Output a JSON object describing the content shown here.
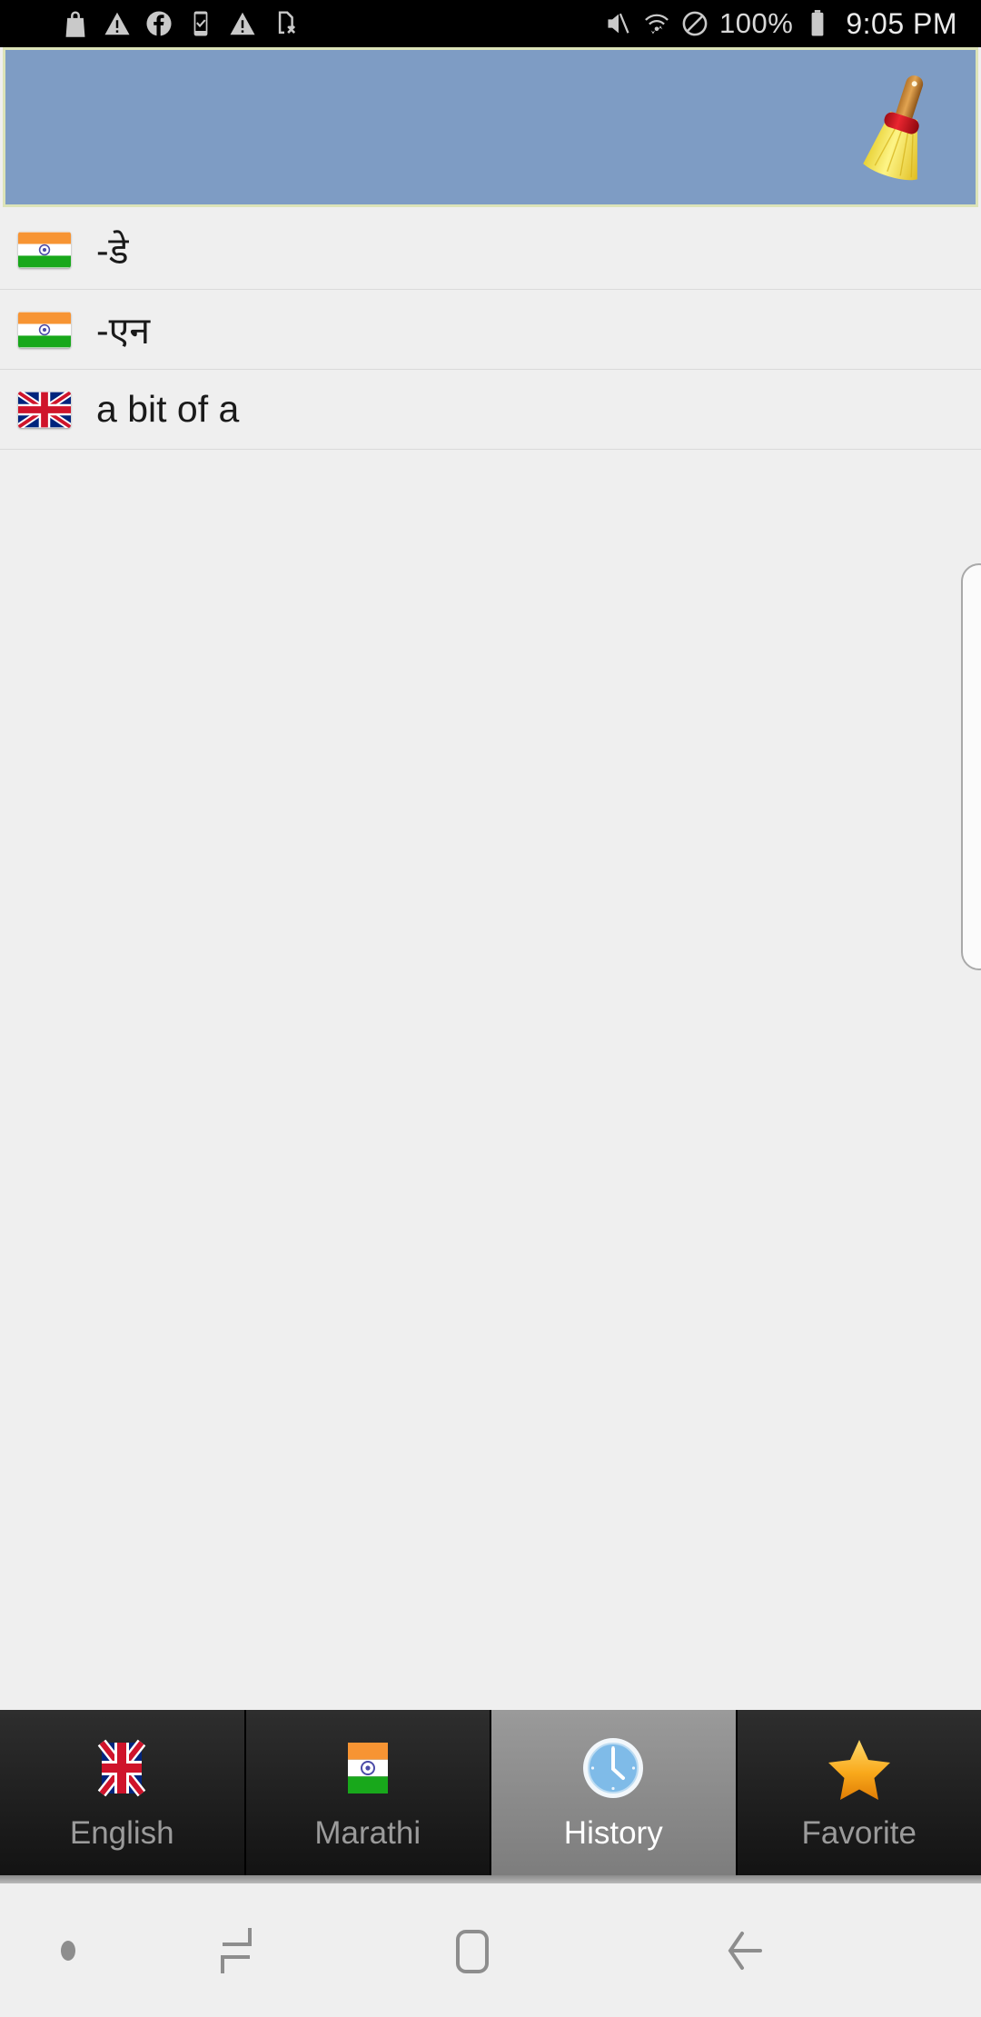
{
  "status_bar": {
    "icons_left": [
      "shopping-bag-icon",
      "warning-triangle-icon",
      "facebook-icon",
      "phone-check-icon",
      "warning-triangle-icon",
      "sim-card-error-icon"
    ],
    "icons_right": [
      "mute-icon",
      "wifi-transfer-icon",
      "do-not-disturb-icon"
    ],
    "battery_percent": "100%",
    "battery_icon": "battery-full-icon",
    "time": "9:05 PM"
  },
  "header": {
    "clear_icon": "broom-icon",
    "background_color": "#7e9cc4",
    "border_color": "#dce3b8"
  },
  "history": {
    "items": [
      {
        "flag": "flag-india",
        "text": "-डे"
      },
      {
        "flag": "flag-india",
        "text": "-एन"
      },
      {
        "flag": "flag-uk",
        "text": "a bit of a"
      }
    ]
  },
  "tabs": [
    {
      "label": "English",
      "icon": "flag-uk-icon",
      "active": false
    },
    {
      "label": "Marathi",
      "icon": "flag-india-icon",
      "active": false
    },
    {
      "label": "History",
      "icon": "clock-icon",
      "active": true
    },
    {
      "label": "Favorite",
      "icon": "star-icon",
      "active": false
    }
  ],
  "nav_bar": {
    "dot": "dot-indicator-icon",
    "recents": "recents-icon",
    "home": "home-icon",
    "back": "back-icon"
  },
  "colors": {
    "accent_header": "#7e9cc4",
    "page_background": "#efefef",
    "tab_active": "#8a8a8a",
    "star": "#f5a623"
  }
}
